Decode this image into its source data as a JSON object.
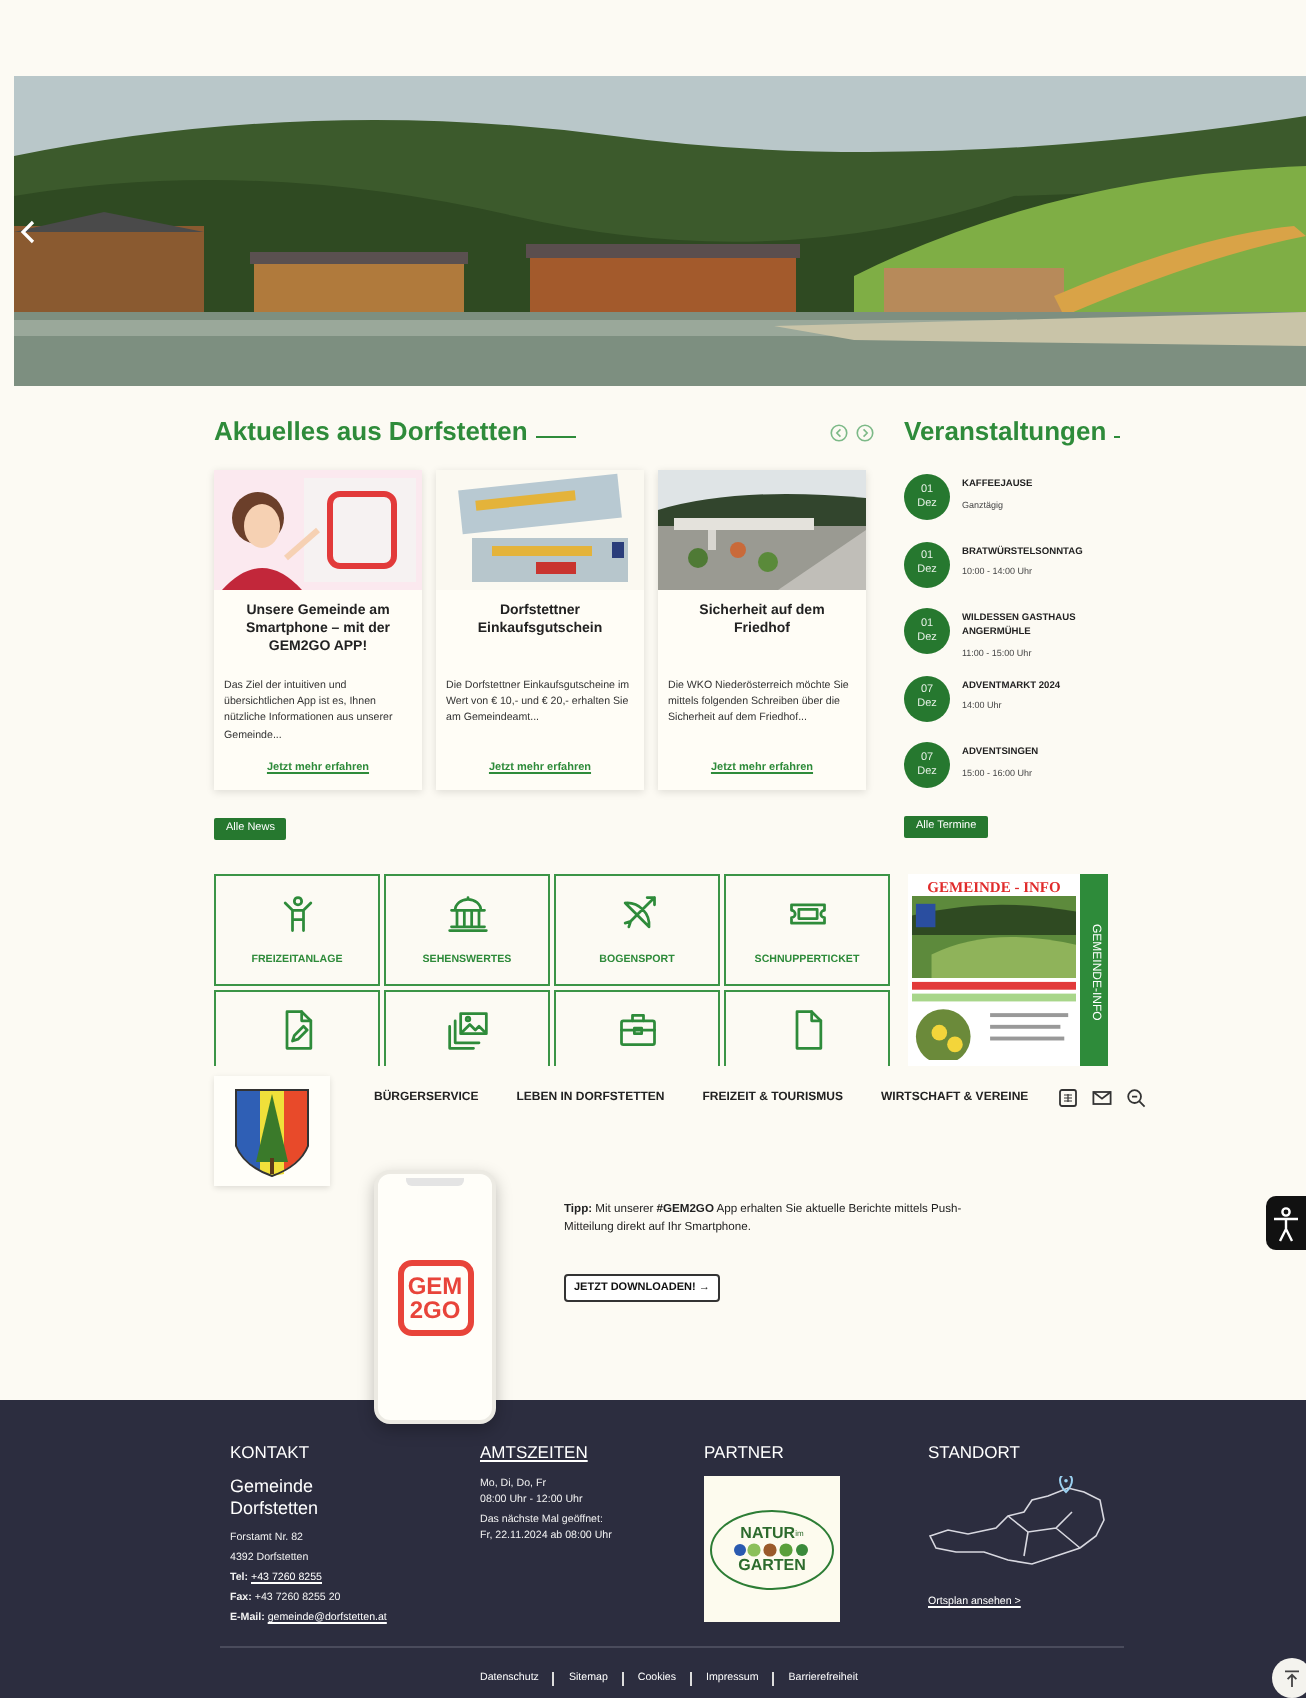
{
  "news": {
    "title": "Aktuelles aus Dorfstetten",
    "articles": [
      {
        "title": "Unsere Gemeinde am Smartphone – mit der GEM2GO APP!",
        "excerpt": "Das Ziel der intuitiven und übersichtlichen App ist es, Ihnen nützliche Informationen aus unserer Gemeinde...",
        "link": "Jetzt mehr erfahren",
        "kind": "app"
      },
      {
        "title": "Dorfstettner Einkaufsgutschein",
        "excerpt": "Die Dorfstettner Einkaufsgutscheine im Wert von € 10,- und € 20,- erhalten Sie am Gemeindeamt...",
        "link": "Jetzt mehr erfahren",
        "kind": "voucher"
      },
      {
        "title": "Sicherheit auf dem Friedhof",
        "excerpt": "Die WKO Niederösterreich möchte Sie mittels folgenden Schreiben über die Sicherheit auf dem Friedhof...",
        "link": "Jetzt mehr erfahren",
        "kind": "cemetery"
      }
    ],
    "all_button": "Alle News"
  },
  "events": {
    "title": "Veranstaltungen",
    "items": [
      {
        "day": "01",
        "month": "Dez",
        "title": "KAFFEEJAUSE",
        "time": "Ganztägig"
      },
      {
        "day": "01",
        "month": "Dez",
        "title": "BRATWÜRSTELSONNTAG",
        "time": "10:00 - 14:00 Uhr"
      },
      {
        "day": "01",
        "month": "Dez",
        "title": "WILDESSEN GASTHAUS ANGERMÜHLE",
        "time": "11:00 - 15:00 Uhr"
      },
      {
        "day": "07",
        "month": "Dez",
        "title": "ADVENTMARKT 2024",
        "time": "14:00 Uhr"
      },
      {
        "day": "07",
        "month": "Dez",
        "title": "ADVENTSINGEN",
        "time": "15:00 - 16:00 Uhr"
      }
    ],
    "all_button": "Alle Termine"
  },
  "tiles": [
    {
      "label": "FREIZEITANLAGE",
      "kind": "person"
    },
    {
      "label": "SEHENSWERTES",
      "kind": "monument"
    },
    {
      "label": "BOGENSPORT",
      "kind": "bow"
    },
    {
      "label": "SCHNUPPERTICKET",
      "kind": "ticket"
    },
    {
      "kind": "document-pen"
    },
    {
      "kind": "photos"
    },
    {
      "kind": "briefcase"
    },
    {
      "kind": "document"
    }
  ],
  "gemeinde_info": {
    "heading": "GEMEINDE - INFO",
    "side_label": "GEMEINDE-INFO"
  },
  "nav": {
    "items": [
      "BÜRGERSERVICE",
      "LEBEN IN DORFSTETTEN",
      "FREIZEIT & TOURISMUS",
      "WIRTSCHAFT & VEREINE"
    ]
  },
  "app_promo": {
    "tip": "**Tipp:** Mit unserer **#GEM2GO** App erhalten Sie aktuelle Berichte mittels Push-Mitteilung direkt auf Ihr Smartphone.",
    "logo_lines": [
      "GEM",
      "2GO"
    ],
    "button": "JETZT DOWNLOADEN! →"
  },
  "footer": {
    "contact": {
      "heading": "KONTAKT",
      "name": "Gemeinde Dorfstetten",
      "lines": [
        {
          "kind": "plain",
          "value": "Forstamt Nr. 82"
        },
        {
          "kind": "plain",
          "value": "4392 Dorfstetten"
        },
        {
          "kind": "link",
          "label": "Tel:",
          "value": "+43 7260 8255"
        },
        {
          "kind": "labeled",
          "label": "Fax:",
          "value": "+43 7260 8255 20"
        },
        {
          "kind": "link",
          "label": "E-Mail:",
          "value": "gemeinde@dorfstetten.at"
        }
      ]
    },
    "hours": {
      "heading": "AMTSZEITEN",
      "lines": [
        "Mo, Di, Do, Fr",
        "08:00 Uhr - 12:00 Uhr",
        "Das nächste Mal geöffnet:",
        "Fr, 22.11.2024 ab 08:00 Uhr"
      ]
    },
    "partner": {
      "heading": "PARTNER",
      "logo_top": "NATUR",
      "logo_small": "im",
      "logo_bottom": "GARTEN"
    },
    "location": {
      "heading": "STANDORT",
      "link": "Ortsplan ansehen >"
    },
    "bottom_links": [
      "Datenschutz",
      "Sitemap",
      "Cookies",
      "Impressum",
      "Barrierefreiheit"
    ]
  }
}
